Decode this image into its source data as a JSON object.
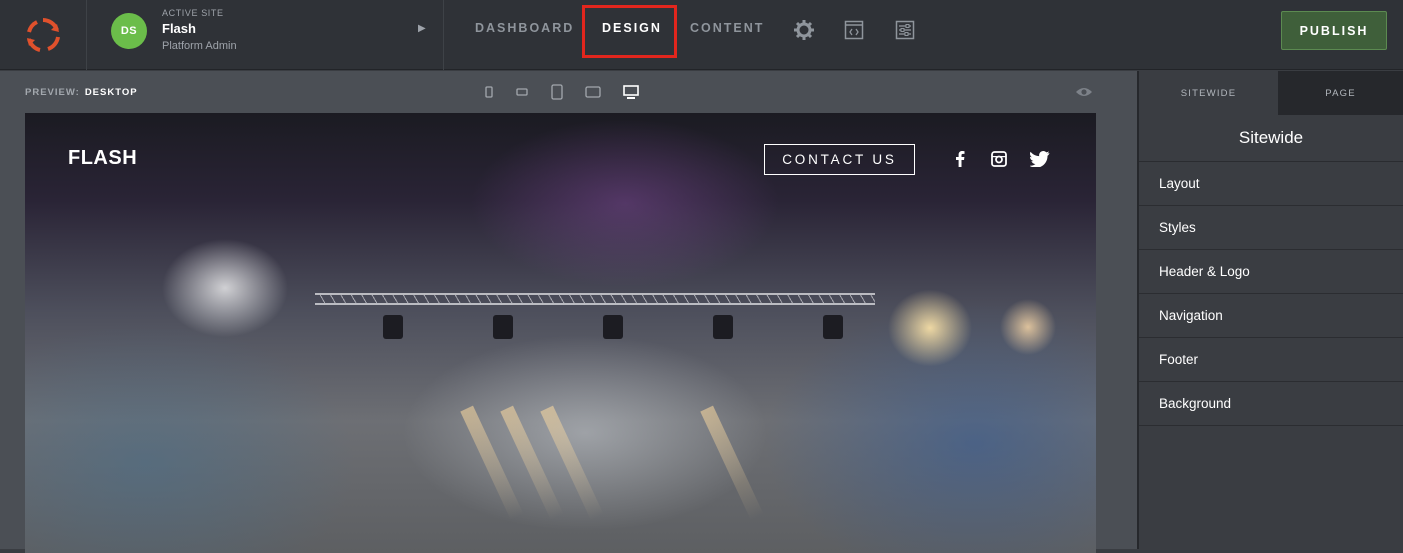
{
  "topbar": {
    "logo_icon": "refresh-cycle-icon",
    "site": {
      "avatar_initials": "DS",
      "label": "ACTIVE SITE",
      "name": "Flash",
      "role": "Platform Admin"
    },
    "nav": {
      "dashboard": "DASHBOARD",
      "design": "DESIGN",
      "content": "CONTENT"
    },
    "icons": [
      "gear-icon",
      "code-window-icon",
      "sliders-icon"
    ],
    "publish_label": "PUBLISH"
  },
  "preview": {
    "label": "PREVIEW:",
    "mode": "DESKTOP",
    "devices": [
      "phone-portrait-icon",
      "phone-landscape-icon",
      "tablet-portrait-icon",
      "tablet-landscape-icon",
      "desktop-icon"
    ]
  },
  "site_preview": {
    "brand": "FLASH",
    "contact_label": "CONTACT US",
    "social": [
      "facebook-icon",
      "instagram-icon",
      "twitter-icon"
    ]
  },
  "sidebar": {
    "tabs": [
      "SITEWIDE",
      "PAGE"
    ],
    "title": "Sitewide",
    "items": [
      "Layout",
      "Styles",
      "Header & Logo",
      "Navigation",
      "Footer",
      "Background"
    ]
  },
  "colors": {
    "accent_green": "#6bbd4a",
    "publish_bg": "#3f5f3a",
    "highlight_red": "#e2261d",
    "logo_orange": "#e0512c"
  }
}
